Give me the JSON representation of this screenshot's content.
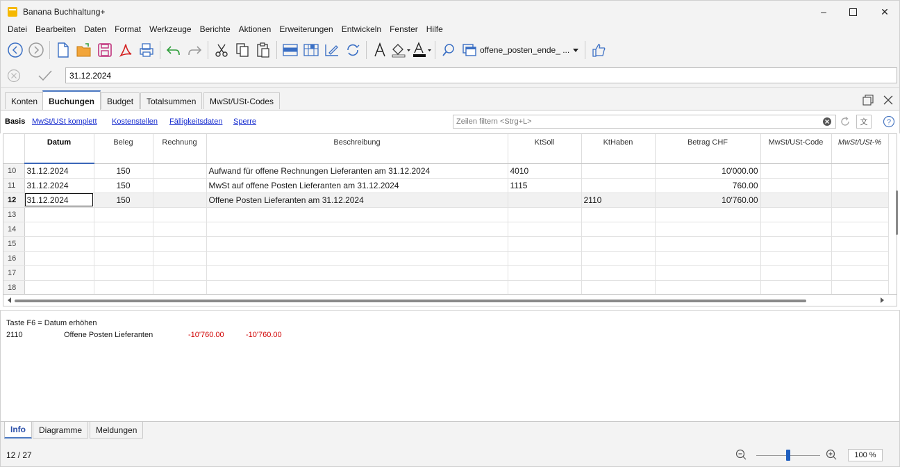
{
  "window": {
    "title": "Banana Buchhaltung+"
  },
  "menu": [
    "Datei",
    "Bearbeiten",
    "Daten",
    "Format",
    "Werkzeuge",
    "Berichte",
    "Aktionen",
    "Erweiterungen",
    "Entwickeln",
    "Fenster",
    "Hilfe"
  ],
  "toolbar": {
    "file_combo": "offene_posten_ende_ ..."
  },
  "editbar": {
    "value": "31.12.2024"
  },
  "tabs": [
    "Konten",
    "Buchungen",
    "Budget",
    "Totalsummen",
    "MwSt/USt-Codes"
  ],
  "active_tab": "Buchungen",
  "views": [
    "Basis",
    "MwSt/USt komplett",
    "Kostenstellen",
    "Fälligkeitsdaten",
    "Sperre"
  ],
  "filter": {
    "placeholder": "Zeilen filtern <Strg+L>"
  },
  "table": {
    "headers": [
      "Datum",
      "Beleg",
      "Rechnung",
      "Beschreibung",
      "KtSoll",
      "KtHaben",
      "Betrag CHF",
      "MwSt/USt-Code",
      "MwSt/USt-%"
    ],
    "rows": [
      {
        "n": "10",
        "datum": "31.12.2024",
        "beleg": "150",
        "rechnung": "",
        "beschreibung": "Aufwand für offene Rechnungen Lieferanten am 31.12.2024",
        "ktsoll": "4010",
        "kthaben": "",
        "betrag": "10'000.00",
        "code": "",
        "pct": ""
      },
      {
        "n": "11",
        "datum": "31.12.2024",
        "beleg": "150",
        "rechnung": "",
        "beschreibung": "MwSt auf offene Posten Lieferanten am 31.12.2024",
        "ktsoll": "1115",
        "kthaben": "",
        "betrag": "760.00",
        "code": "",
        "pct": ""
      },
      {
        "n": "12",
        "datum": "31.12.2024",
        "beleg": "150",
        "rechnung": "",
        "beschreibung": "Offene Posten Lieferanten am 31.12.2024",
        "ktsoll": "",
        "kthaben": "2110",
        "betrag": "10'760.00",
        "code": "",
        "pct": ""
      },
      {
        "n": "13"
      },
      {
        "n": "14"
      },
      {
        "n": "15"
      },
      {
        "n": "16"
      },
      {
        "n": "17"
      },
      {
        "n": "18"
      }
    ]
  },
  "info": {
    "hint": "Taste F6 = Datum erhöhen",
    "account": "2110",
    "account_name": "Offene Posten Lieferanten",
    "amount1": "-10'760.00",
    "amount2": "-10'760.00"
  },
  "bottom_tabs": [
    "Info",
    "Diagramme",
    "Meldungen"
  ],
  "status": {
    "position": "12 / 27",
    "zoom": "100 %",
    "zoom_level": 0.5
  },
  "colors": {
    "accent": "#4a78c2",
    "link": "#1a2fd0",
    "negative": "#d00000",
    "zoom_thumb": "#1f5fbf"
  }
}
